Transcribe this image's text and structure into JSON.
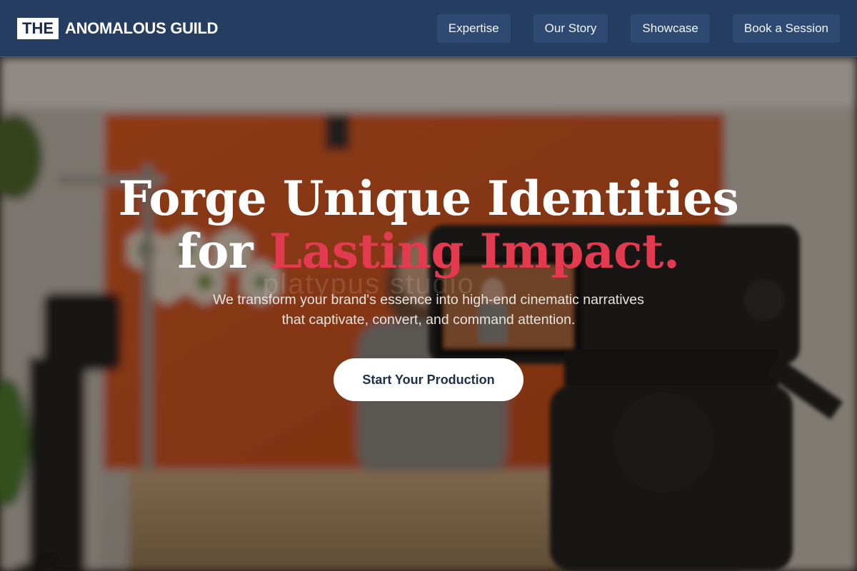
{
  "header": {
    "logo_box": "THE",
    "logo_text": "ANOMALOUS GUILD",
    "nav": [
      {
        "label": "Expertise"
      },
      {
        "label": "Our Story"
      },
      {
        "label": "Showcase"
      },
      {
        "label": "Book a Session"
      }
    ]
  },
  "hero": {
    "headline_line1": "Forge Unique Identities",
    "headline_line2_prefix": "for ",
    "headline_line2_accent": "Lasting Impact.",
    "subtitle_line1": "We transform your brand's essence into high-end cinematic narratives",
    "subtitle_line2": "that captivate, convert, and command attention.",
    "cta_label": "Start Your Production",
    "watermark": "platypus studio",
    "background_description": "blurred video production studio with orange wall, hexagonal shelves, camera on tripod"
  },
  "colors": {
    "header_bg": "#263d62",
    "nav_button_bg": "#2e4a72",
    "accent": "#e23a4e",
    "cta_bg": "#ffffff",
    "cta_text": "#1f2f4a"
  }
}
